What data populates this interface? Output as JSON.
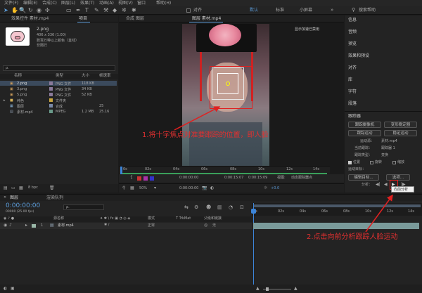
{
  "menubar": {
    "items": [
      "文件(F)",
      "编辑(E)",
      "合成(C)",
      "图层(L)",
      "效果(T)",
      "动画(A)",
      "视图(V)",
      "窗口",
      "帮助(H)"
    ]
  },
  "toolbar": {
    "align_label": "对齐",
    "workspaces": [
      "默认",
      "标准",
      "小屏幕"
    ],
    "search_placeholder": "搜索帮助"
  },
  "project_panel": {
    "tab_effects": "效果控件 素材.mp4",
    "tab_project": "项目",
    "selected_name": "2.png",
    "selected_info": "406 x 336 (1.00)",
    "selected_info2": "数百万种以上颜色（直线）",
    "selected_info3": "非隔行",
    "search_placeholder": "ρ.",
    "columns": [
      "名称",
      "类型",
      "大小",
      "帧速率"
    ],
    "items": [
      {
        "name": "2.png",
        "type": "PNG 文件",
        "size": "118 KB",
        "fps": ""
      },
      {
        "name": "3.png",
        "type": "PNG 文件",
        "size": "34 KB",
        "fps": ""
      },
      {
        "name": "5.png",
        "type": "PNG 文件",
        "size": "52 KB",
        "fps": ""
      },
      {
        "name": "纯色",
        "type": "文件夹",
        "size": "",
        "fps": ""
      },
      {
        "name": "图层",
        "type": "合成",
        "size": "",
        "fps": "25"
      },
      {
        "name": "素材.mp4",
        "type": "MPEG",
        "size": "1.2 MB",
        "fps": "25.16"
      }
    ],
    "footer_bpc": "8 bpc"
  },
  "composition_panel": {
    "tab_comp": "合成 图层",
    "tab_layer": "图层 素材.mp4",
    "hint": "显示加速已禁用",
    "timecodes": [
      "0s",
      "02s",
      "04s",
      "06s",
      "08s",
      "10s",
      "12s",
      "14s"
    ],
    "current_time": "0:00:00:00",
    "duration": "0:00:15:07",
    "end_time": "0:00:15:09",
    "view_label": "视图:",
    "view_value": "动态跟踪器点",
    "zoom": "50%",
    "time2": "0:00:00:00",
    "offset": "+0.0"
  },
  "right_panel": {
    "items": [
      "信息",
      "音频",
      "预览",
      "效果和预设",
      "对齐",
      "库",
      "字符",
      "段落"
    ],
    "tracker": {
      "title": "跟踪器",
      "btn_camera": "跟踪摄像机",
      "btn_stabilize": "变形稳定器",
      "btn_motion": "跟踪运动",
      "btn_stabilize_motion": "稳定运动",
      "source_label": "运动源：",
      "source_value": "素材.mp4",
      "current_label": "当前跟踪：",
      "current_value": "跟踪器 1",
      "type_label": "跟踪类型：",
      "type_value": "变换",
      "opt_position": "位置",
      "opt_rotation": "旋转",
      "opt_scale": "缩放",
      "target_label": "运动目标：",
      "btn_edit_target": "编辑目标...",
      "btn_options": "选项...",
      "analyze_label": "分析：",
      "tooltip": "向前分析"
    }
  },
  "timeline": {
    "tab_layer": "图层",
    "tab_render": "渲染队列",
    "current_time": "0:00:00:00",
    "frame_info": "00000 (25.00 fps)",
    "search_placeholder": "ρ.",
    "col_name": "源名称",
    "col_mode": "模式",
    "col_trkmat": "T TrkMat",
    "col_parent": "父级和链接",
    "layer_num": "1",
    "layer_name": "素材.mp4",
    "layer_mode": "正常",
    "layer_parent": "无",
    "ruler": [
      "0s",
      "02s",
      "04s",
      "06s",
      "08s",
      "10s",
      "12s",
      "14s"
    ]
  },
  "annotations": {
    "note1": "1.将十字焦点对准要跟踪的位置，即人脸",
    "note2": "2.点击向前分析跟踪人脸运动",
    "accent": "#e02020"
  }
}
